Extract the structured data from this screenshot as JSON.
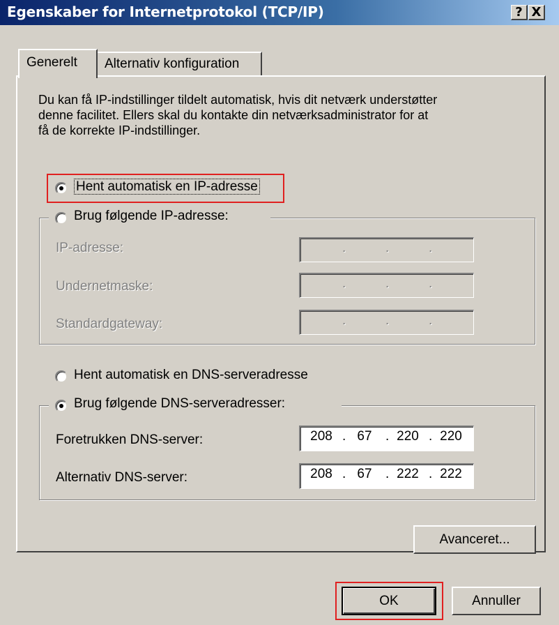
{
  "window": {
    "title": "Egenskaber for Internetprotokol (TCP/IP)",
    "help_glyph": "?",
    "close_glyph": "X"
  },
  "tabs": [
    {
      "label": "Generelt",
      "selected": true
    },
    {
      "label": "Alternativ konfiguration",
      "selected": false
    }
  ],
  "description": {
    "line1": "Du kan få IP-indstillinger tildelt automatisk, hvis dit netværk understøtter",
    "line2": "denne facilitet. Ellers skal du kontakte din netværksadministrator for at",
    "line3": "få de korrekte IP-indstillinger."
  },
  "ip_section": {
    "auto_label": "Hent automatisk en IP-adresse",
    "auto_selected": true,
    "manual_label": "Brug følgende IP-adresse:",
    "manual_selected": false,
    "fields": [
      {
        "label": "IP-adresse:",
        "octets": [
          "",
          "",
          "",
          ""
        ]
      },
      {
        "label": "Undernetmaske:",
        "octets": [
          "",
          "",
          "",
          ""
        ]
      },
      {
        "label": "Standardgateway:",
        "octets": [
          "",
          "",
          "",
          ""
        ]
      }
    ]
  },
  "dns_section": {
    "auto_label": "Hent automatisk en DNS-serveradresse",
    "auto_selected": false,
    "manual_label": "Brug følgende DNS-serveradresser:",
    "manual_selected": true,
    "fields": [
      {
        "label": "Foretrukken DNS-server:",
        "octets": [
          "208",
          "67",
          "220",
          "220"
        ]
      },
      {
        "label": "Alternativ DNS-server:",
        "octets": [
          "208",
          "67",
          "222",
          "222"
        ]
      }
    ]
  },
  "buttons": {
    "advanced": "Avanceret...",
    "ok": "OK",
    "cancel": "Annuller"
  },
  "colors": {
    "highlight_box": "#e02020",
    "dialog_bg": "#d4d0c8",
    "titlebar_start": "#0a246a"
  }
}
